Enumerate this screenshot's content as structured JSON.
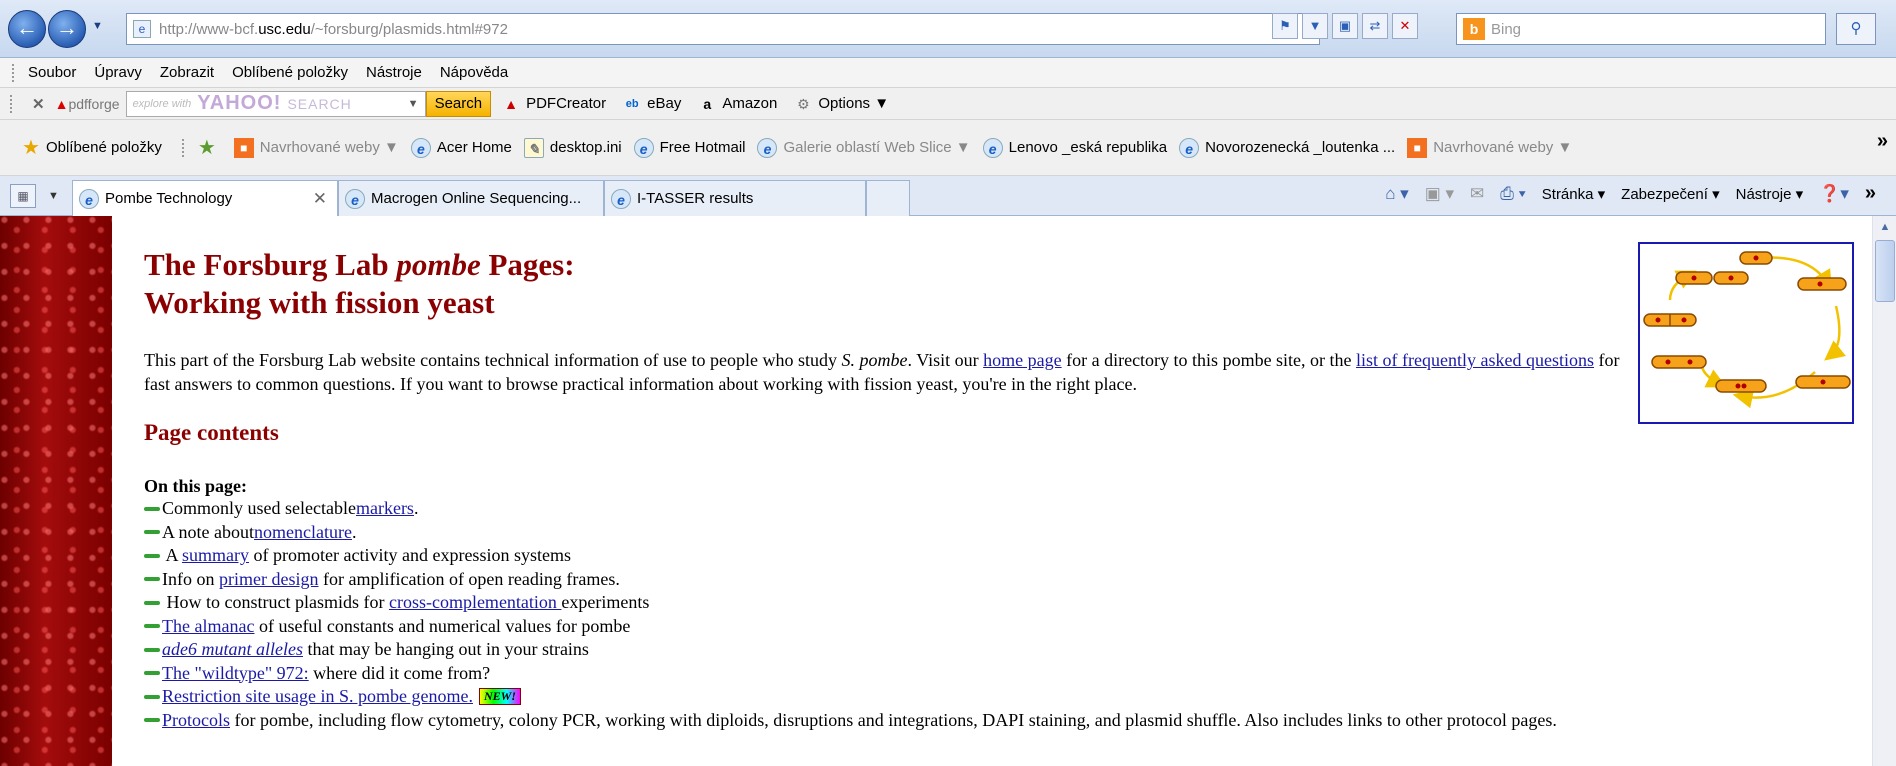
{
  "browser": {
    "url_prefix": "http://www-bcf.",
    "url_domain": "usc.edu",
    "url_suffix": "/~forsburg/plasmids.html#972",
    "search_placeholder": "Bing",
    "menu": [
      "Soubor",
      "Úpravy",
      "Zobrazit",
      "Oblíbené položky",
      "Nástroje",
      "Nápověda"
    ],
    "toolbar": {
      "pdfforge": "pdfforge",
      "yahoo_hint": "explore with",
      "yahoo_logo": "YAHOO!",
      "yahoo_search": "SEARCH",
      "search_button": "Search",
      "items": [
        "PDFCreator",
        "eBay",
        "Amazon",
        "Options"
      ]
    },
    "favorites": {
      "label": "Oblíbené položky",
      "items": [
        "Navrhované weby",
        "Acer Home",
        "desktop.ini",
        "Free Hotmail",
        "Galerie oblastí Web Slice",
        "Lenovo _eská republika",
        "Novorozenecká _loutenka ...",
        "Navrhované weby"
      ]
    },
    "tabs": [
      "Pombe Technology",
      "Macrogen Online Sequencing...",
      "I-TASSER results"
    ],
    "commands": [
      "Stránka",
      "Zabezpečení",
      "Nástroje"
    ],
    "colors": {
      "chrome": "#dfe9f7",
      "heading": "#8b0000",
      "link": "#1a1aa6",
      "bullet": "#33a033"
    }
  },
  "page": {
    "title_line1_a": "The Forsburg Lab ",
    "title_line1_em": "pombe",
    "title_line1_b": " Pages:",
    "title_line2": "Working with fission yeast",
    "intro": {
      "t1": "This part of the Forsburg Lab website contains technical information of use to people who study ",
      "em": "S. pombe",
      "t2": ". Visit our ",
      "link1": "home page",
      "t3": " for a directory to this pombe site, or the ",
      "link2": "list of frequently asked questions",
      "t4": " for fast answers to common questions. If you want to browse practical information about working with fission yeast, you're in the right place."
    },
    "contents_heading": "Page contents",
    "on_this_page": "On this page:",
    "items": [
      {
        "pre": "Commonly used selectable ",
        "link": "markers",
        "post": "."
      },
      {
        "pre": "A note about ",
        "link": "nomenclature",
        "post": "."
      },
      {
        "pre": " A ",
        "link": "summary",
        "post": " of promoter activity and expression systems"
      },
      {
        "pre": "Info on ",
        "link": "primer design",
        "post": " for amplification of open reading frames."
      },
      {
        "pre": " How to construct plasmids for ",
        "link": "cross-complementation ",
        "post": "experiments"
      },
      {
        "pre": "",
        "link": "The almanac",
        "post": " of useful constants and numerical values for pombe"
      },
      {
        "pre": "",
        "link": "ade6 mutant alleles",
        "post": " that may be hanging out in your strains"
      },
      {
        "pre": "",
        "link": "The \"wildtype\" 972:",
        "post": " where did it come from?"
      },
      {
        "pre": "",
        "link": "Restriction site usage in S. pombe genome.",
        "post": ""
      },
      {
        "pre": "",
        "link": "Protocols",
        "post": " for pombe, including flow cytometry, colony PCR, working with diploids, disruptions and integrations, DAPI staining, and plasmid shuffle. Also includes links to other protocol pages."
      }
    ],
    "new_badge": "NEW!"
  }
}
